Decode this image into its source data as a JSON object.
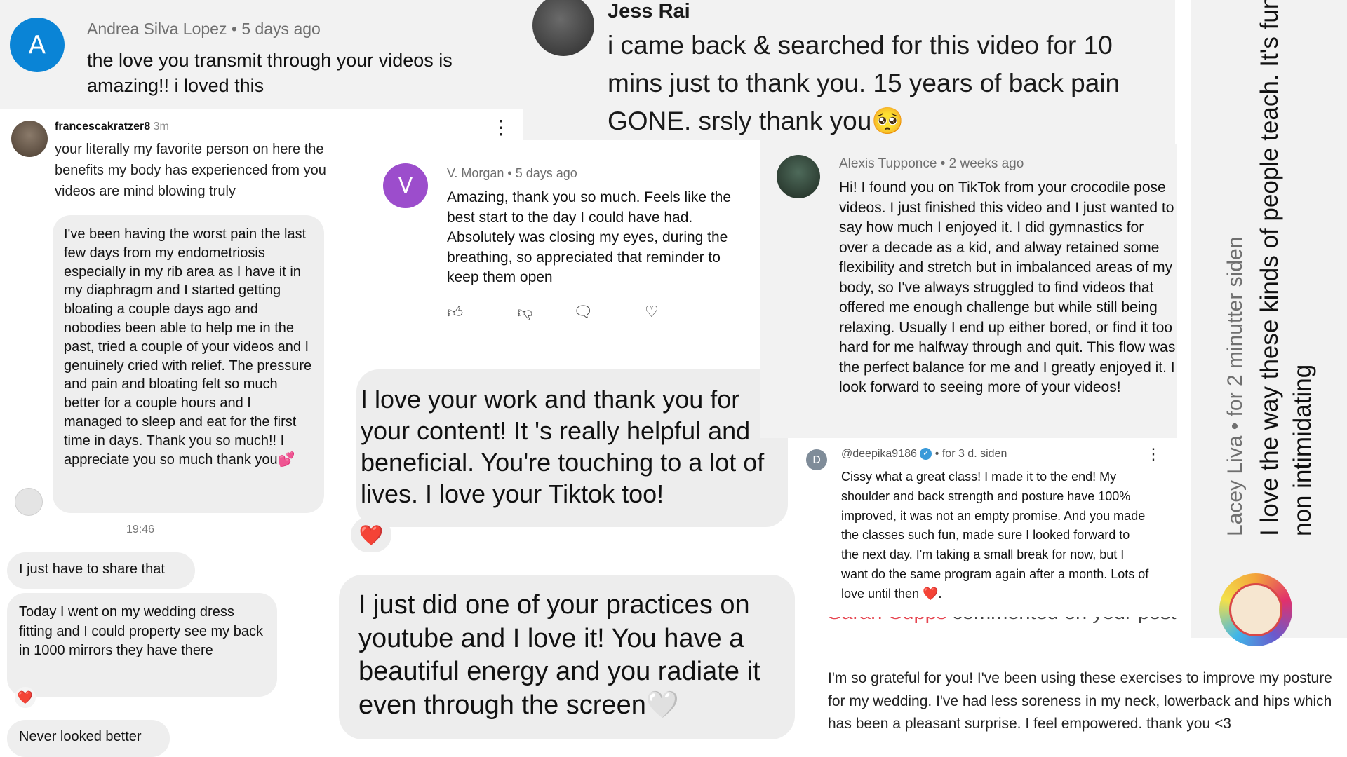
{
  "andrea": {
    "avatar": "A",
    "meta": "Andrea Silva Lopez  •  5 days ago",
    "text": "the love you transmit through your videos is amazing!! i loved this"
  },
  "jess": {
    "name": "Jess Rai",
    "text": "i came back & searched for this video for 10 mins just to thank you. 15 years of back pain GONE. srsly thank you🥺"
  },
  "instagram": {
    "username": "francescakratzer8",
    "time_ago": "3m",
    "intro": "your literally my favorite person on here the benefits my body has experienced from you videos are mind blowing truly",
    "bubble1": "I've been having the worst pain the last few days from my endometriosis especially in my rib area as I have it in my diaphragm and I started getting bloating a couple days ago and nobodies been able to help me in the past, tried a couple of your videos and I genuinely cried with relief. The pressure and pain and bloating felt so much better for a couple hours and I managed to sleep and eat for the first time in days. Thank you so much!! I appreciate you so much thank you💕",
    "timestamp": "19:46",
    "bubble2": "I just have to share that",
    "bubble3": "Today I went on my wedding dress fitting and I could property see my back in 1000 mirrors they have there",
    "reaction": "❤️",
    "bubble4": "Never looked better"
  },
  "morgan": {
    "avatar": "V",
    "meta": "V. Morgan  •  5 days ago",
    "text": "Amazing, thank you so much. Feels like the best start to the day I could have had. Absolutely was closing my eyes, during the breathing, so appreciated that reminder to keep them open",
    "icons": [
      "thumbs-up-icon",
      "thumbs-down-icon",
      "reply-icon",
      "heart-icon"
    ]
  },
  "tiktok_bubble": {
    "text": "I love your work and thank you for your content! It 's really helpful and beneficial. You're touching to a lot of lives. I love your Tiktok too!",
    "reaction": "❤️"
  },
  "youtube_bubble": {
    "text": "I just did one of your practices on youtube and I love it! You have a beautiful energy and you radiate it even through the screen🤍"
  },
  "alexis": {
    "meta": "Alexis Tupponce  •  2 weeks ago",
    "text": "Hi! I found you on TikTok from your crocodile pose videos. I just finished this video and I just wanted to say how much I enjoyed it. I did gymnastics for over a decade as a kid, and alway retained some flexibility and stretch but in imbalanced areas of my body, so I've always struggled to find videos that offered me enough challenge but while still being relaxing. Usually I end up either bored, or find it too hard for me halfway through and quit. This flow was the perfect balance for me and I greatly enjoyed it. I look forward to seeing more of your videos!"
  },
  "deepika": {
    "avatar": "D",
    "handle": "@deepika9186",
    "time_ago": "• for 3 d. siden",
    "text": "Cissy what a great class! I made it to the end! My shoulder and back strength and posture have 100% improved, it was not an empty promise. And you made the classes such fun, made sure I looked forward to the next day. I'm taking a small break for now, but I want do the same program again after a month. Lots of love until then ❤️."
  },
  "sarah": {
    "name": "Sarah Cupps",
    "action": "commented on your post",
    "text": "I'm so grateful for you! I've been using these exercises to improve my posture for my wedding. I've had less soreness in my neck, lowerback and hips which has been a pleasant surprise. I feel empowered. thank you <3"
  },
  "lacey": {
    "meta": "Lacey Liva  •  for 2 minutter siden",
    "text": "I love the way these kinds of people teach. It's fun and non intimidating"
  }
}
